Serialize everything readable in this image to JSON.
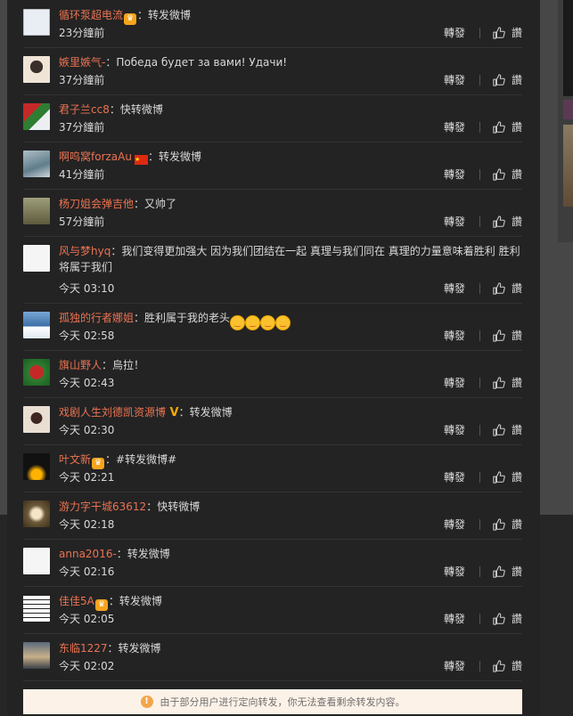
{
  "feed": {
    "forward_label": "轉發",
    "like_label": "讚",
    "items": [
      {
        "name": "循环泵超电流",
        "badge": true,
        "text": "：转发微博",
        "time": "23分鐘前"
      },
      {
        "name": "嫉里嫉气-",
        "text": "：Победа будет за вами! Удачи!",
        "time": "37分鐘前"
      },
      {
        "name": "君子兰cc8",
        "text": "：快转微博",
        "time": "37分鐘前"
      },
      {
        "name": "啊呜窝forzaAu",
        "flag": true,
        "text": "：转发微博",
        "time": "41分鐘前"
      },
      {
        "name": "杨刀姐会弹吉他",
        "text": "：又帅了",
        "time": "57分鐘前"
      },
      {
        "name": "风与梦hyq",
        "text": "：我们变得更加强大 因为我们团结在一起 真理与我们同在 真理的力量意味着胜利 胜利将属于我们",
        "time": "今天 03:10"
      },
      {
        "name": "孤独的行者娜姐",
        "text": "：胜利属于我的老头",
        "emojis": 4,
        "time": "今天 02:58"
      },
      {
        "name": "旗山野人",
        "text": "：烏拉！",
        "time": "今天 02:43"
      },
      {
        "name": "戏剧人生刘德凯资源博",
        "vip": true,
        "text": "：转发微博",
        "time": "今天 02:30"
      },
      {
        "name": "叶文新",
        "badge": true,
        "text": "：#转发微博#",
        "time": "今天 02:21"
      },
      {
        "name": "游力字干城63612",
        "text": "：快转微博",
        "time": "今天 02:18"
      },
      {
        "name": "anna2016-",
        "text": "：转发微博",
        "time": "今天 02:16"
      },
      {
        "name": "佳佳5A",
        "badge": true,
        "text": "：转发微博",
        "time": "今天 02:05"
      },
      {
        "name": "东临1227",
        "text": "：转发微博",
        "time": "今天 02:02"
      }
    ]
  },
  "notice": {
    "icon": "warning-icon",
    "text": "由于部分用户进行定向转发，你无法查看剩余转发内容。"
  },
  "colors": {
    "accent": "#eb7350",
    "card_bg": "#232324",
    "notice_bg": "#fdf2e8"
  }
}
